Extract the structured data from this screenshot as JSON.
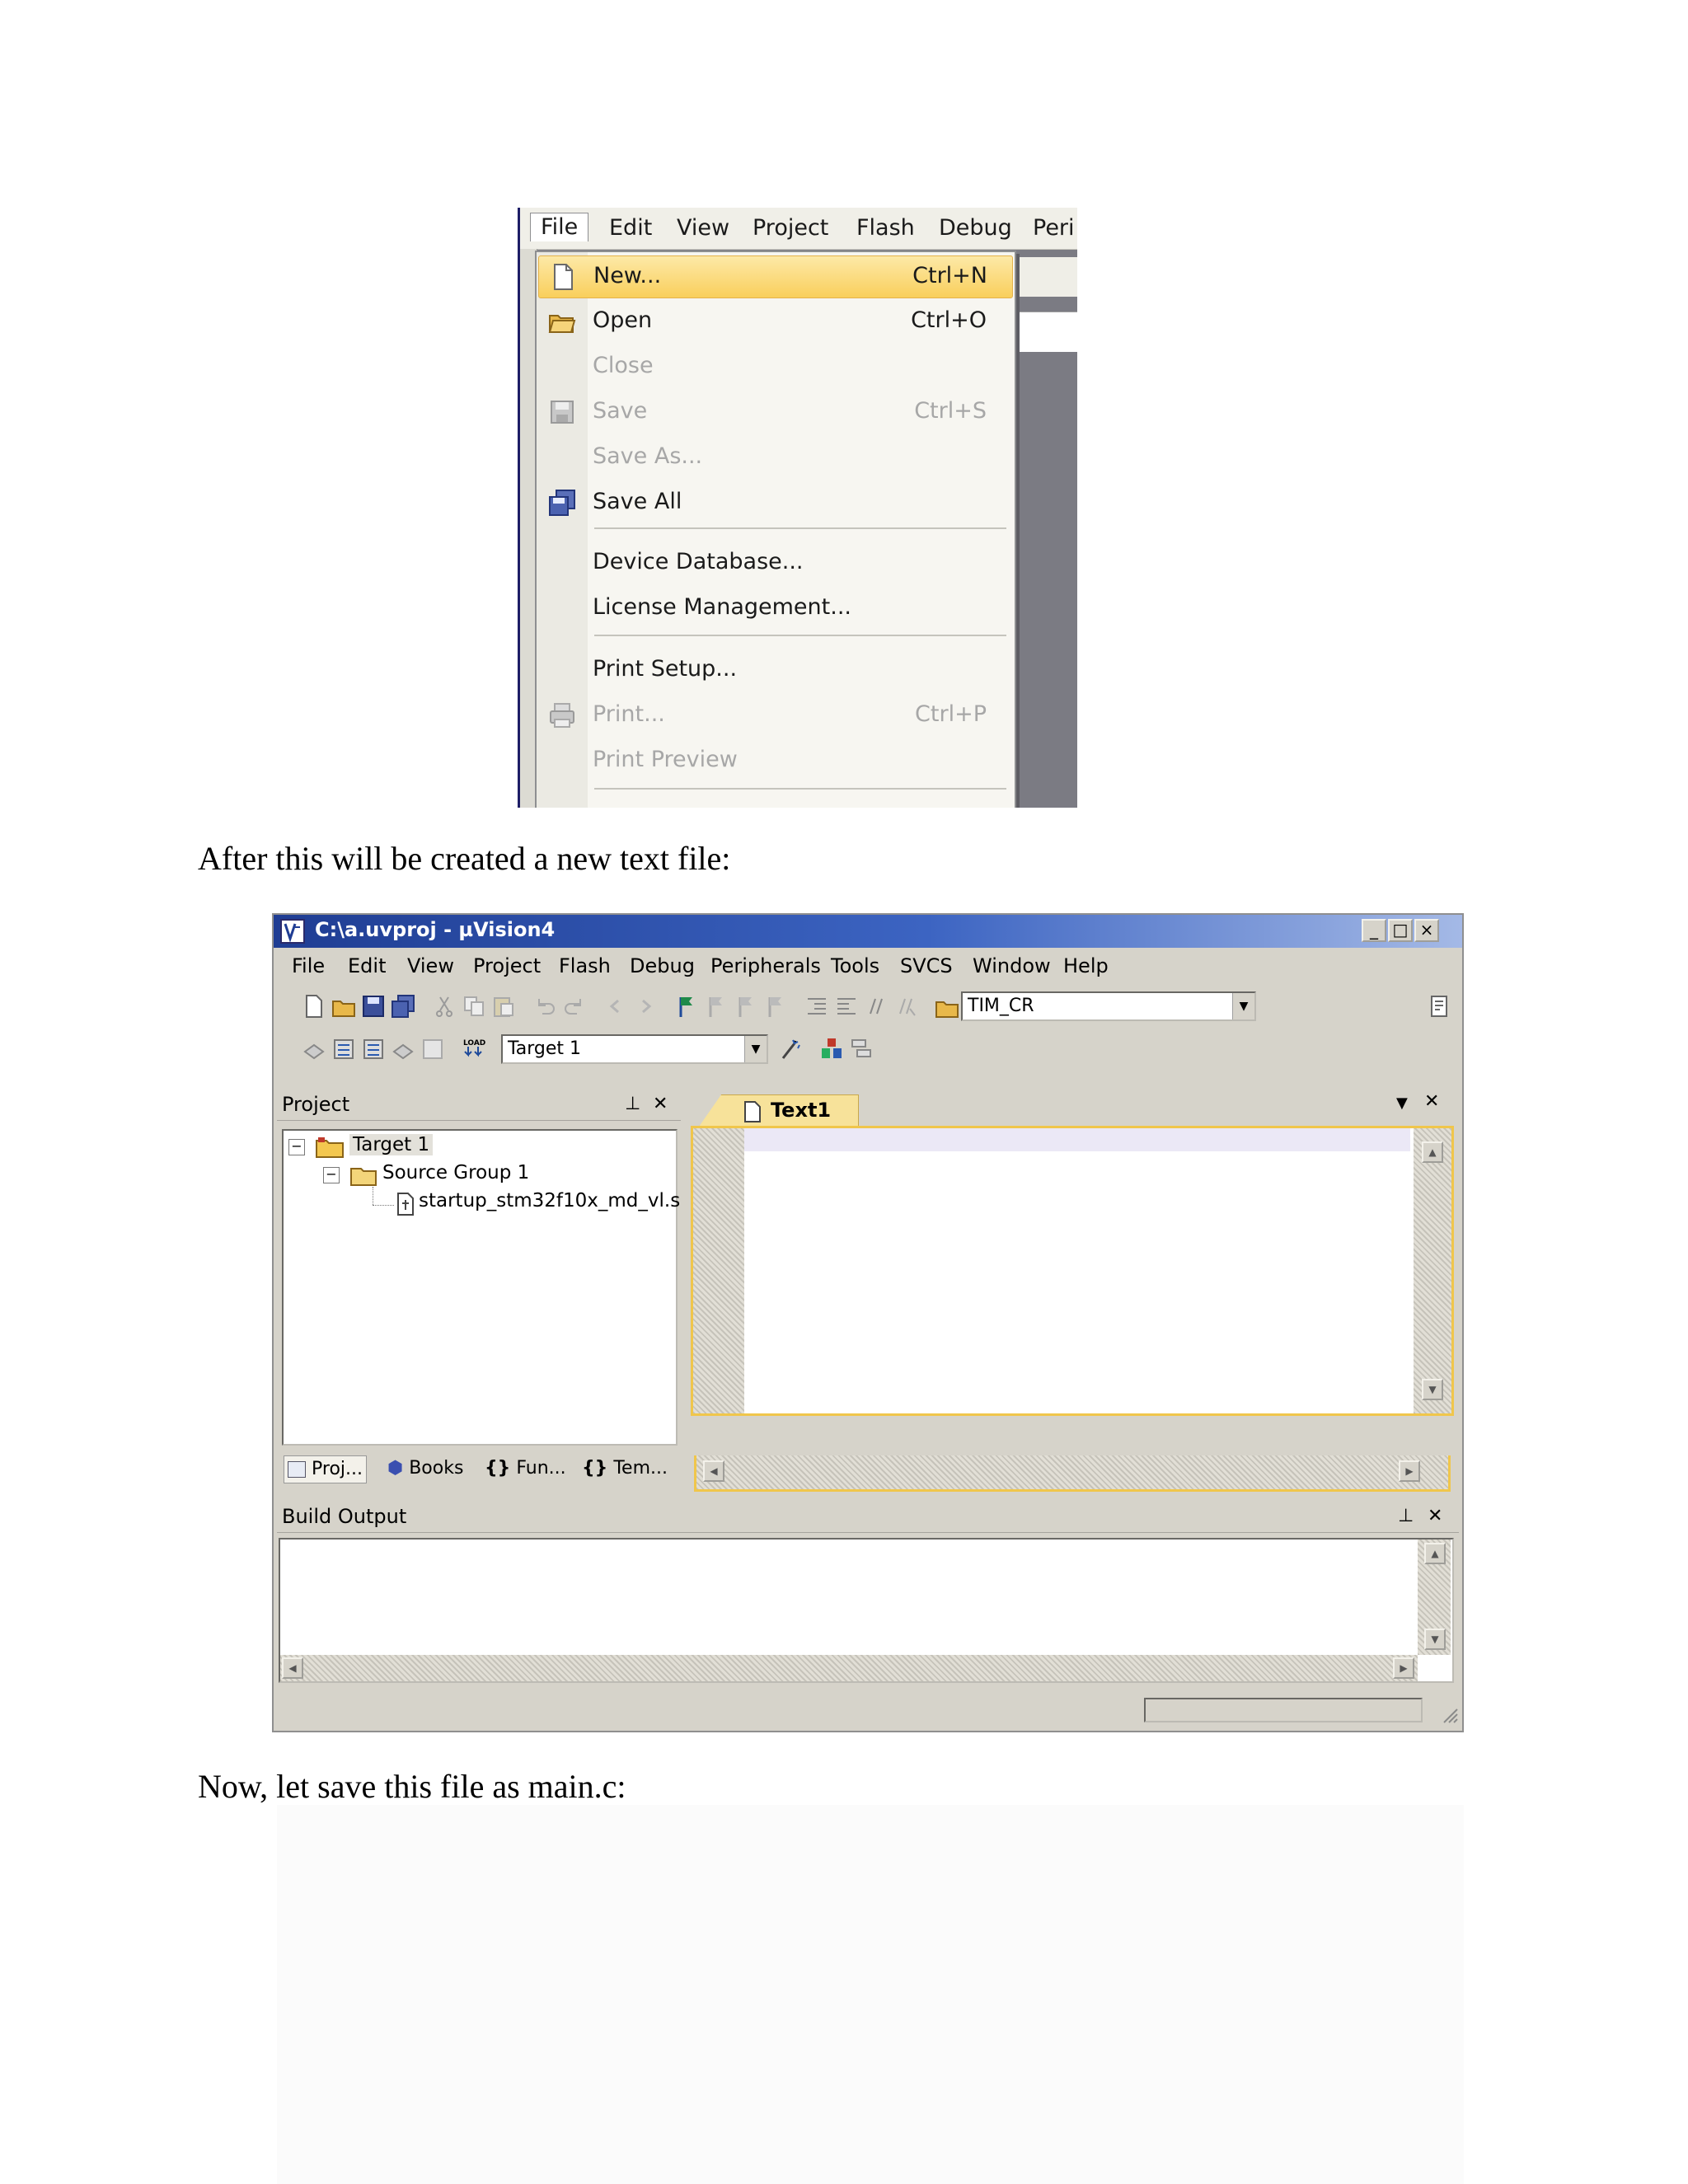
{
  "file_menu_shot": {
    "menubar": [
      "File",
      "Edit",
      "View",
      "Project",
      "Flash",
      "Debug",
      "Peri"
    ],
    "items": [
      {
        "label": "New...",
        "shortcut": "Ctrl+N",
        "icon": "new-file-icon",
        "state": "highlighted"
      },
      {
        "label": "Open",
        "shortcut": "Ctrl+O",
        "icon": "open-folder-icon",
        "state": "enabled"
      },
      {
        "label": "Close",
        "shortcut": "",
        "icon": "",
        "state": "disabled"
      },
      {
        "label": "Save",
        "shortcut": "Ctrl+S",
        "icon": "save-disk-icon",
        "state": "disabled"
      },
      {
        "label": "Save As...",
        "shortcut": "",
        "icon": "",
        "state": "disabled"
      },
      {
        "label": "Save All",
        "shortcut": "",
        "icon": "save-all-icon",
        "state": "enabled"
      },
      {
        "label": "Device Database...",
        "shortcut": "",
        "icon": "",
        "state": "enabled"
      },
      {
        "label": "License Management...",
        "shortcut": "",
        "icon": "",
        "state": "enabled"
      },
      {
        "label": "Print Setup...",
        "shortcut": "",
        "icon": "",
        "state": "enabled"
      },
      {
        "label": "Print...",
        "shortcut": "Ctrl+P",
        "icon": "printer-icon",
        "state": "disabled"
      },
      {
        "label": "Print Preview",
        "shortcut": "",
        "icon": "",
        "state": "disabled"
      }
    ]
  },
  "paragraphs": {
    "p1": "After this will be created a new text file:",
    "p2": "Now, let save this file as main.c:"
  },
  "uvision_shot": {
    "title": "C:\\a.uvproj - µVision4",
    "window_buttons": [
      "_",
      "□",
      "×"
    ],
    "menubar": [
      "File",
      "Edit",
      "View",
      "Project",
      "Flash",
      "Debug",
      "Peripherals",
      "Tools",
      "SVCS",
      "Window",
      "Help"
    ],
    "find_combo": "TIM_CR",
    "target_combo": "Target 1",
    "load_label": "LOAD",
    "project_panel_title": "Project",
    "tree": {
      "target": "Target 1",
      "group": "Source Group 1",
      "file": "startup_stm32f10x_md_vl.s"
    },
    "project_tabs": [
      "Proj...",
      "Books",
      "Fun...",
      "Tem..."
    ],
    "editor_tab": "Text1",
    "build_output_title": "Build Output",
    "colors": {
      "title_start": "#1f3d93",
      "title_end": "#a4b9e6",
      "editor_border": "#f0c64b",
      "highlight": "#f9cf5c"
    }
  }
}
